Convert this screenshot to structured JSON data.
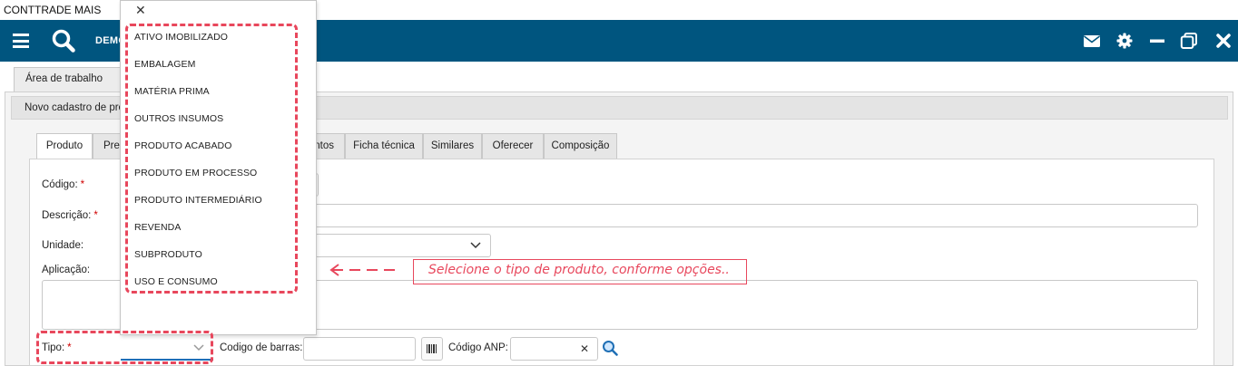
{
  "window": {
    "title": "CONTTRADE MAIS"
  },
  "appbar": {
    "company": "DEMO",
    "icons": [
      "menu-icon",
      "search-icon",
      "mail-icon",
      "gear-icon",
      "minimize-icon",
      "restore-icon",
      "close-icon"
    ]
  },
  "worktab": {
    "label": "Área de trabalho"
  },
  "panel": {
    "title": "Novo cadastro de proc"
  },
  "tabs": [
    "Produto",
    "Pre",
    "ntos",
    "Ficha técnica",
    "Similares",
    "Oferecer",
    "Composição"
  ],
  "form": {
    "codigo_label": "Código:",
    "descricao_label": "Descrição:",
    "unidade_label": "Unidade:",
    "aplicacao_label": "Aplicação:",
    "tipo_label": "Tipo:",
    "required_mark": "*",
    "codigo_barras_label": "Codigo de barras:",
    "codigo_anp_label": "Código ANP:",
    "codigo_anp_clear": "✕"
  },
  "dropdown": {
    "close": "✕",
    "options": [
      "ATIVO IMOBILIZADO",
      "EMBALAGEM",
      "MATÉRIA PRIMA",
      "OUTROS INSUMOS",
      "PRODUTO ACABADO",
      "PRODUTO EM PROCESSO",
      "PRODUTO INTERMEDIÁRIO",
      "REVENDA",
      "SUBPRODUTO",
      "USO E CONSUMO"
    ]
  },
  "annotation": {
    "text": "Selecione o tipo de produto, conforme opções..",
    "color": "#e8475c"
  },
  "colors": {
    "appbar": "#00557f",
    "focus": "#1e6fb8"
  }
}
